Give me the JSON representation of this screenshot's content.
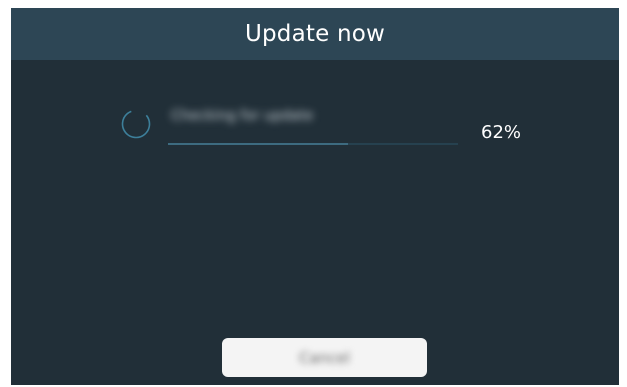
{
  "dialog": {
    "title": "Update now",
    "status_text": "Checking for update",
    "progress": {
      "percent_label": "62%",
      "value": 0.62
    },
    "cancel_label": "Cancel"
  },
  "colors": {
    "page_background": "#ffffff",
    "dialog_background": "#212f38",
    "titlebar_background": "#2d4655",
    "spinner": "#3d7f9a",
    "button_background": "#f4f4f4"
  },
  "icons": {
    "spinner": "loading-spinner-icon"
  }
}
